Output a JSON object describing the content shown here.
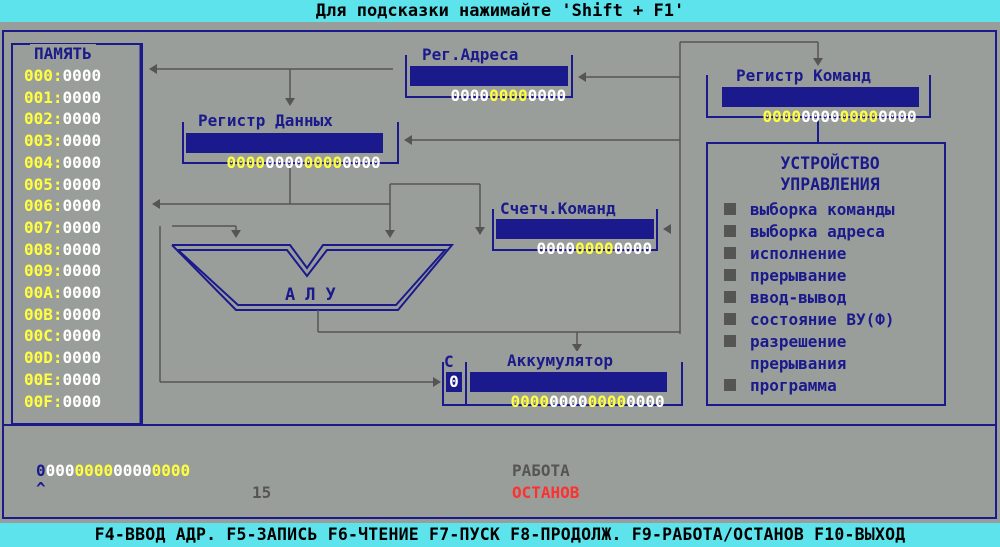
{
  "top_bar": "Для подсказки нажимайте 'Shift + F1'",
  "memory": {
    "title": "ПАМЯТЬ",
    "rows": [
      {
        "addr": "000",
        "val": "0000"
      },
      {
        "addr": "001",
        "val": "0000"
      },
      {
        "addr": "002",
        "val": "0000"
      },
      {
        "addr": "003",
        "val": "0000"
      },
      {
        "addr": "004",
        "val": "0000"
      },
      {
        "addr": "005",
        "val": "0000"
      },
      {
        "addr": "006",
        "val": "0000"
      },
      {
        "addr": "007",
        "val": "0000"
      },
      {
        "addr": "008",
        "val": "0000"
      },
      {
        "addr": "009",
        "val": "0000"
      },
      {
        "addr": "00A",
        "val": "0000"
      },
      {
        "addr": "00B",
        "val": "0000"
      },
      {
        "addr": "00C",
        "val": "0000"
      },
      {
        "addr": "00D",
        "val": "0000"
      },
      {
        "addr": "00E",
        "val": "0000"
      },
      {
        "addr": "00F",
        "val": "0000"
      }
    ]
  },
  "address_register": {
    "title": "Рег.Адреса",
    "bits": [
      "0000",
      "0000",
      "0000"
    ]
  },
  "data_register": {
    "title": "Регистр Данных",
    "bits": [
      "0000",
      "0000",
      "0000",
      "0000"
    ]
  },
  "instruction_register": {
    "title": "Регистр Команд",
    "bits": [
      "0000",
      "0000",
      "0000",
      "0000"
    ]
  },
  "program_counter": {
    "title": "Счетч.Команд",
    "bits": [
      "0000",
      "0000",
      "0000"
    ]
  },
  "accumulator": {
    "title": "Аккумулятор",
    "bits": [
      "0000",
      "0000",
      "0000",
      "0000"
    ]
  },
  "carry": {
    "label": "C",
    "value": "0"
  },
  "alu": {
    "label": "АЛУ"
  },
  "control_unit": {
    "title_line1": "УСТРОЙСТВО",
    "title_line2": "УПРАВЛЕНИЯ",
    "items": [
      "выборка команды",
      "выборка адреса",
      "исполнение",
      "прерывание",
      "ввод-вывод",
      "состояние ВУ(Ф)",
      "разрешение\nпрерывания",
      "программа"
    ]
  },
  "input_line": {
    "first": "0",
    "rest": [
      "000",
      "0000",
      "0000",
      "0000"
    ]
  },
  "caret": "^",
  "position": "15",
  "mode_run": "РАБОТА",
  "mode_stop": "ОСТАНОВ",
  "bottom_bar": "F4-ВВОД АДР. F5-ЗАПИСЬ F6-ЧТЕНИЕ F7-ПУСК F8-ПРОДОЛЖ. F9-РАБОТА/ОСТАНОВ F10-ВЫХОД",
  "colors": {
    "background": "#9a9e9a",
    "bar": "#5ce3ec",
    "frame": "#1a1a8c",
    "nibble_a": "#ffffff",
    "nibble_b": "#ffff40",
    "stop": "#ff3030"
  }
}
